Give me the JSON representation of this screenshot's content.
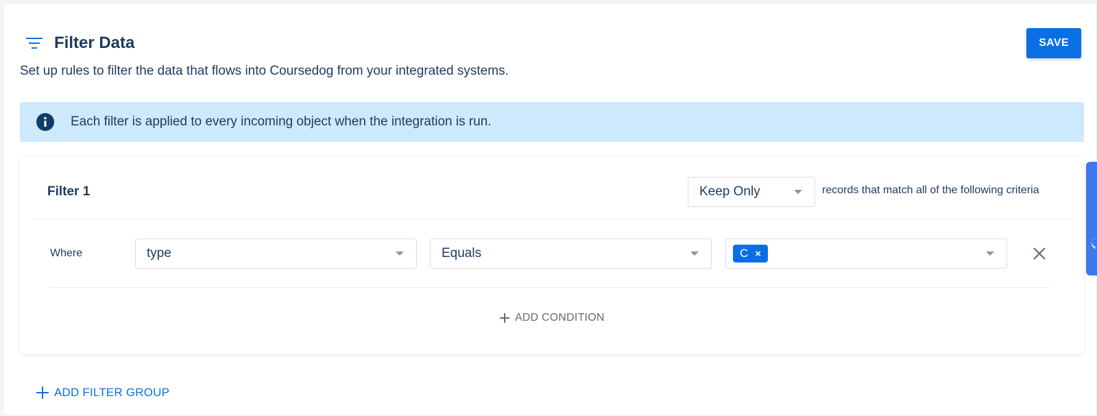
{
  "header": {
    "title": "Filter Data",
    "save_label": "SAVE",
    "subtitle": "Set up rules to filter the data that flows into Coursedog from your integrated systems."
  },
  "info": {
    "text": "Each filter is applied to every incoming object when the integration is run."
  },
  "filter": {
    "name": "Filter 1",
    "mode": "Keep Only",
    "criteria_text": "records that match all of the following criteria",
    "condition": {
      "prefix": "Where",
      "field": "type",
      "operator": "Equals",
      "values": [
        "C"
      ]
    },
    "add_condition_label": "ADD CONDITION"
  },
  "add_group_label": "ADD FILTER GROUP",
  "icons": {
    "filter": "filter-lines-icon",
    "info": "info-circle-icon",
    "remove": "close-icon",
    "add": "plus-icon",
    "dropdown": "caret-down-icon"
  },
  "colors": {
    "primary": "#0b6fe4",
    "info_bg": "#cde9fb",
    "text": "#1f3a5f"
  }
}
